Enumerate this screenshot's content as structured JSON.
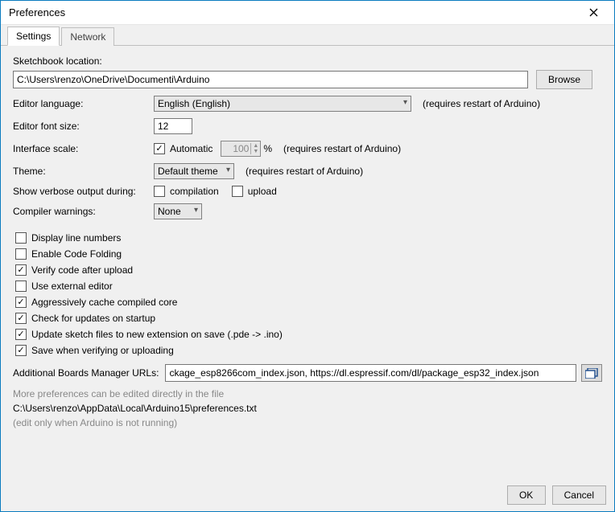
{
  "window": {
    "title": "Preferences"
  },
  "tabs": {
    "settings": "Settings",
    "network": "Network"
  },
  "labels": {
    "sketchbook": "Sketchbook location:",
    "editor_lang": "Editor language:",
    "font_size": "Editor font size:",
    "interface_scale": "Interface scale:",
    "theme": "Theme:",
    "verbose": "Show verbose output during:",
    "compiler_warnings": "Compiler warnings:",
    "additional_urls": "Additional Boards Manager URLs:",
    "restart_note": "(requires restart of Arduino)"
  },
  "values": {
    "sketchbook_path": "C:\\Users\\renzo\\OneDrive\\Documenti\\Arduino",
    "language": "English (English)",
    "font_size": "12",
    "scale_auto_label": "Automatic",
    "scale_value": "100",
    "scale_unit": "%",
    "theme": "Default theme",
    "compilation_label": "compilation",
    "upload_label": "upload",
    "compiler_warnings": "None",
    "urls": "ckage_esp8266com_index.json, https://dl.espressif.com/dl/package_esp32_index.json"
  },
  "checkboxes": {
    "display_line_numbers": "Display line numbers",
    "enable_code_folding": "Enable Code Folding",
    "verify_after_upload": "Verify code after upload",
    "use_external_editor": "Use external editor",
    "aggressive_cache": "Aggressively cache compiled core",
    "check_updates": "Check for updates on startup",
    "update_ext": "Update sketch files to new extension on save (.pde -> .ino)",
    "save_when_verify": "Save when verifying or uploading"
  },
  "buttons": {
    "browse": "Browse",
    "ok": "OK",
    "cancel": "Cancel"
  },
  "footer_text": {
    "more_prefs": "More preferences can be edited directly in the file",
    "prefs_path": "C:\\Users\\renzo\\AppData\\Local\\Arduino15\\preferences.txt",
    "edit_only": "(edit only when Arduino is not running)"
  }
}
